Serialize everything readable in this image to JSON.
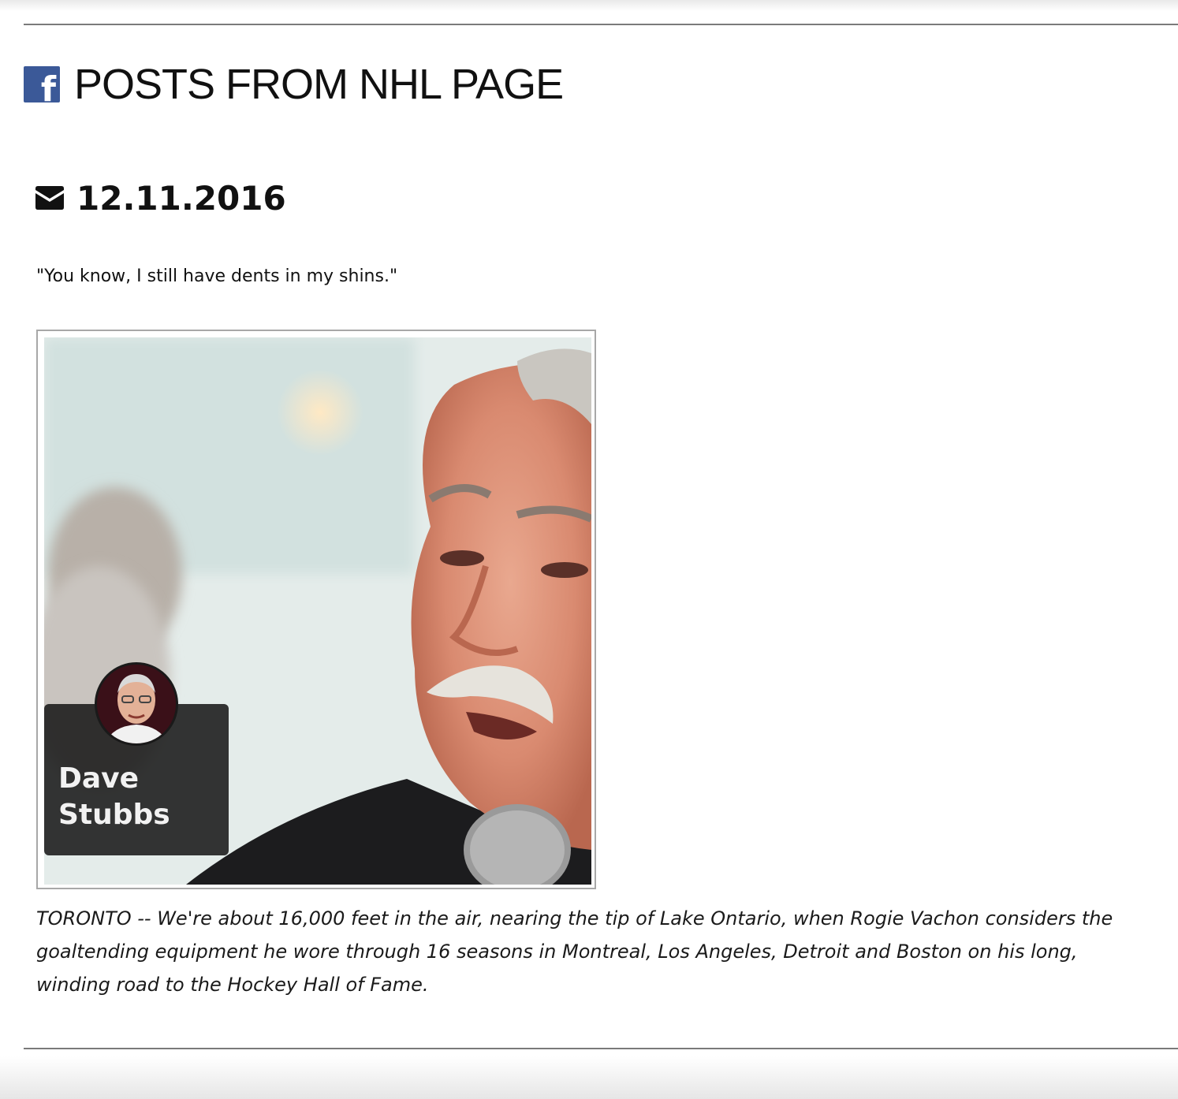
{
  "header": {
    "icon": "facebook-icon",
    "title": "POSTS FROM NHL PAGE",
    "brand_color": "#3b5998"
  },
  "post": {
    "icon": "envelope-icon",
    "date": "12.11.2016",
    "quote": "\"You know, I still have dents in my shins.\"",
    "image": {
      "author_first": "Dave",
      "author_last": "Stubbs"
    },
    "snippet": "TORONTO -- We're about 16,000 feet in the air, nearing the tip of Lake Ontario, when Rogie Vachon considers the goaltending equipment he wore through 16 seasons in Montreal, Los Angeles, Detroit and Boston on his long, winding road to the Hockey Hall of Fame."
  }
}
